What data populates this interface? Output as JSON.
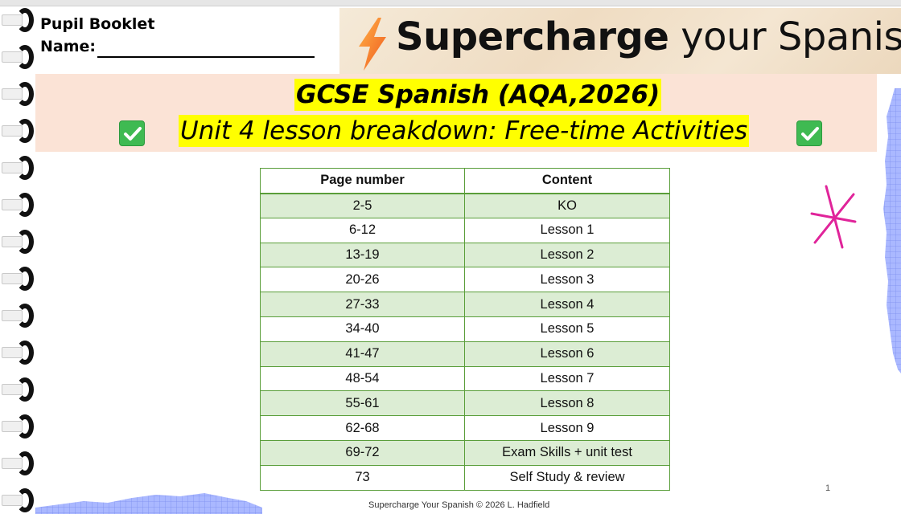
{
  "header": {
    "booklet_label": "Pupil Booklet",
    "name_label": "Name:"
  },
  "banner": {
    "bold_text": "Supercharge",
    "rest_text": " your Spanish"
  },
  "title": {
    "line1": "GCSE Spanish (AQA,2026)",
    "line2": "Unit 4 lesson breakdown: Free-time Activities"
  },
  "table": {
    "headers": [
      "Page number",
      "Content"
    ],
    "rows": [
      [
        "2-5",
        "KO"
      ],
      [
        "6-12",
        "Lesson 1"
      ],
      [
        "13-19",
        "Lesson 2"
      ],
      [
        "20-26",
        "Lesson 3"
      ],
      [
        "27-33",
        "Lesson 4"
      ],
      [
        "34-40",
        "Lesson 5"
      ],
      [
        "41-47",
        "Lesson 6"
      ],
      [
        "48-54",
        "Lesson 7"
      ],
      [
        "55-61",
        "Lesson 8"
      ],
      [
        "62-68",
        "Lesson 9"
      ],
      [
        "69-72",
        "Exam Skills + unit test"
      ],
      [
        "73",
        "Self Study & review"
      ]
    ]
  },
  "page_number": "1",
  "footer": "Supercharge Your Spanish © 2026 L. Hadfield",
  "icons": {
    "check_left": "check-mark-button-icon",
    "check_right": "check-mark-button-icon",
    "bolt": "lightning-bolt-icon",
    "star": "star-doodle-icon"
  },
  "colors": {
    "title_band": "#fbe3d6",
    "highlight": "#ffff00",
    "table_border": "#5a9e3a",
    "table_alt_row": "#dcedd4",
    "check_green": "#3fba52",
    "star_pink": "#e0249a",
    "graph_blue": "#9fb0ff"
  }
}
